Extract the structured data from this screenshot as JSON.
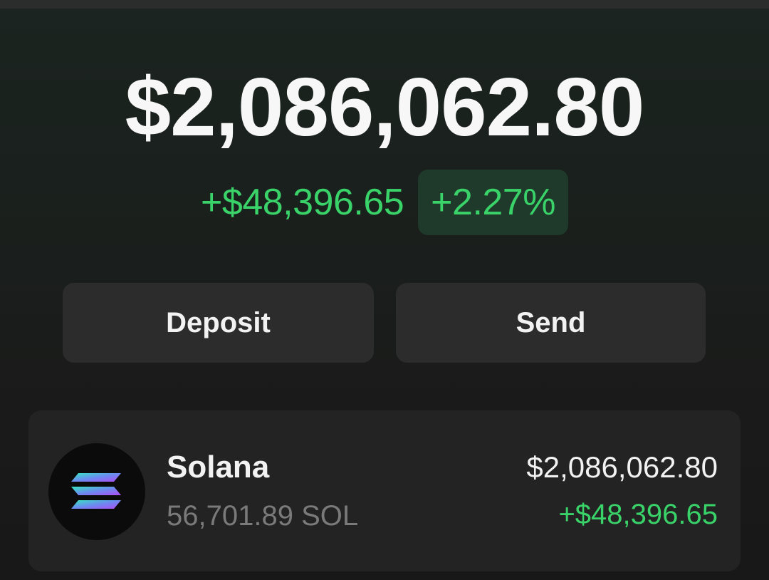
{
  "wallet": {
    "total_balance": "$2,086,062.80",
    "change_amount": "+$48,396.65",
    "change_percent": "+2.27%"
  },
  "actions": {
    "deposit_label": "Deposit",
    "send_label": "Send"
  },
  "assets": [
    {
      "name": "Solana",
      "quantity": "56,701.89 SOL",
      "value": "$2,086,062.80",
      "change": "+$48,396.65",
      "icon": "solana-logo-icon"
    }
  ],
  "colors": {
    "positive": "#39d36a",
    "badge_background": "#1f3a2a",
    "button_background": "#2c2c2c",
    "card_background": "#232323"
  }
}
